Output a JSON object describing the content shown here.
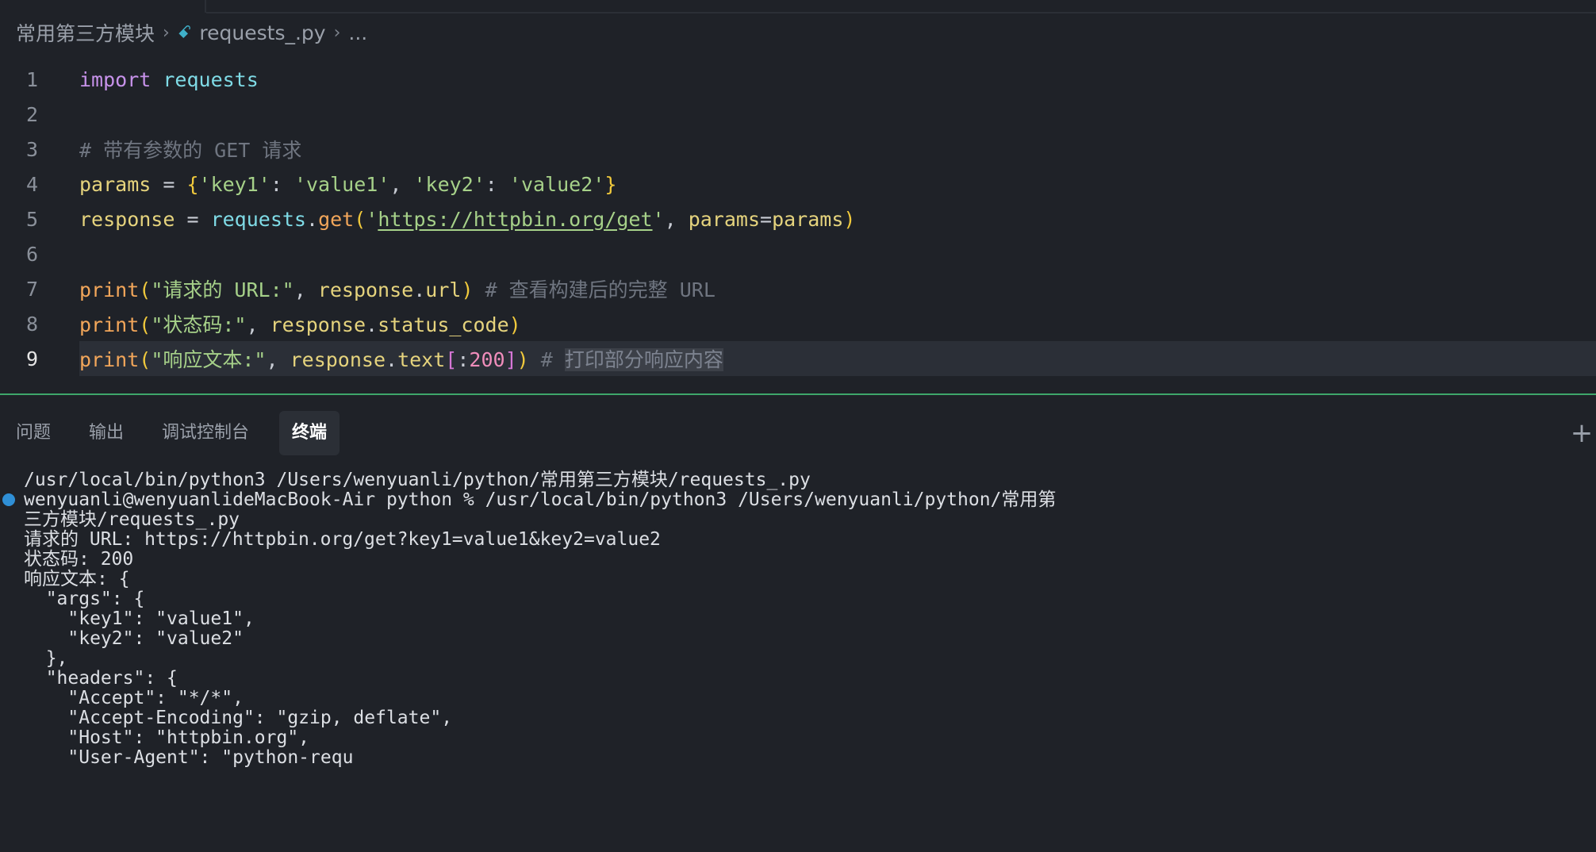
{
  "breadcrumb": {
    "folder": "常用第三方模块",
    "file": "requests_.py",
    "more": "..."
  },
  "editor": {
    "lines": [
      {
        "n": "1",
        "tokens": [
          [
            "kw",
            "import"
          ],
          [
            "op",
            " "
          ],
          [
            "mod",
            "requests"
          ]
        ]
      },
      {
        "n": "2",
        "tokens": []
      },
      {
        "n": "3",
        "tokens": [
          [
            "cmt",
            "# 带有参数的 GET 请求"
          ]
        ]
      },
      {
        "n": "4",
        "tokens": [
          [
            "var",
            "params"
          ],
          [
            "op",
            " = "
          ],
          [
            "br1",
            "{"
          ],
          [
            "str",
            "'key1'"
          ],
          [
            "op",
            ": "
          ],
          [
            "str",
            "'value1'"
          ],
          [
            "op",
            ", "
          ],
          [
            "str",
            "'key2'"
          ],
          [
            "op",
            ": "
          ],
          [
            "str",
            "'value2'"
          ],
          [
            "br1",
            "}"
          ]
        ]
      },
      {
        "n": "5",
        "tokens": [
          [
            "var",
            "response"
          ],
          [
            "op",
            " = "
          ],
          [
            "mod",
            "requests"
          ],
          [
            "op",
            "."
          ],
          [
            "fn",
            "get"
          ],
          [
            "br1",
            "("
          ],
          [
            "str",
            "'"
          ],
          [
            "strurl",
            "https://httpbin.org/get"
          ],
          [
            "str",
            "'"
          ],
          [
            "op",
            ", "
          ],
          [
            "var",
            "params"
          ],
          [
            "op",
            "="
          ],
          [
            "var",
            "params"
          ],
          [
            "br1",
            ")"
          ]
        ]
      },
      {
        "n": "6",
        "tokens": []
      },
      {
        "n": "7",
        "tokens": [
          [
            "fn",
            "print"
          ],
          [
            "br1",
            "("
          ],
          [
            "str",
            "\"请求的 URL:\""
          ],
          [
            "op",
            ", "
          ],
          [
            "var",
            "response"
          ],
          [
            "op",
            "."
          ],
          [
            "var",
            "url"
          ],
          [
            "br1",
            ")"
          ],
          [
            "op",
            " "
          ],
          [
            "cmt",
            "# 查看构建后的完整 URL"
          ]
        ]
      },
      {
        "n": "8",
        "tokens": [
          [
            "fn",
            "print"
          ],
          [
            "br1",
            "("
          ],
          [
            "str",
            "\"状态码:\""
          ],
          [
            "op",
            ", "
          ],
          [
            "var",
            "response"
          ],
          [
            "op",
            "."
          ],
          [
            "var",
            "status_code"
          ],
          [
            "br1",
            ")"
          ]
        ]
      },
      {
        "n": "9",
        "current": true,
        "tokens": [
          [
            "fn",
            "print"
          ],
          [
            "br1",
            "("
          ],
          [
            "str",
            "\"响应文本:\""
          ],
          [
            "op",
            ", "
          ],
          [
            "var",
            "response"
          ],
          [
            "op",
            "."
          ],
          [
            "var",
            "text"
          ],
          [
            "br2",
            "["
          ],
          [
            "op",
            ":"
          ],
          [
            "num-lit",
            "200"
          ],
          [
            "br2",
            "]"
          ],
          [
            "br1",
            ")"
          ],
          [
            "op",
            " "
          ],
          [
            "cmt",
            "# "
          ],
          [
            "sel",
            "打印部分响应内容"
          ]
        ]
      }
    ]
  },
  "panel": {
    "tabs": [
      {
        "label": "问题",
        "active": false
      },
      {
        "label": "输出",
        "active": false
      },
      {
        "label": "调试控制台",
        "active": false
      },
      {
        "label": "终端",
        "active": true
      }
    ]
  },
  "terminal": {
    "lines": [
      {
        "text": "/usr/local/bin/python3 /Users/wenyuanli/python/常用第三方模块/requests_.py"
      },
      {
        "text": "wenyuanli@wenyuanlideMacBook-Air python % /usr/local/bin/python3 /Users/wenyuanli/python/常用第",
        "dot": true
      },
      {
        "text": "三方模块/requests_.py"
      },
      {
        "text": "请求的 URL: https://httpbin.org/get?key1=value1&key2=value2"
      },
      {
        "text": "状态码: 200"
      },
      {
        "text": "响应文本: {"
      },
      {
        "text": "  \"args\": {"
      },
      {
        "text": "    \"key1\": \"value1\","
      },
      {
        "text": "    \"key2\": \"value2\""
      },
      {
        "text": "  },"
      },
      {
        "text": "  \"headers\": {"
      },
      {
        "text": "    \"Accept\": \"*/*\","
      },
      {
        "text": "    \"Accept-Encoding\": \"gzip, deflate\","
      },
      {
        "text": "    \"Host\": \"httpbin.org\","
      },
      {
        "text": "    \"User-Agent\": \"python-requ"
      }
    ]
  }
}
